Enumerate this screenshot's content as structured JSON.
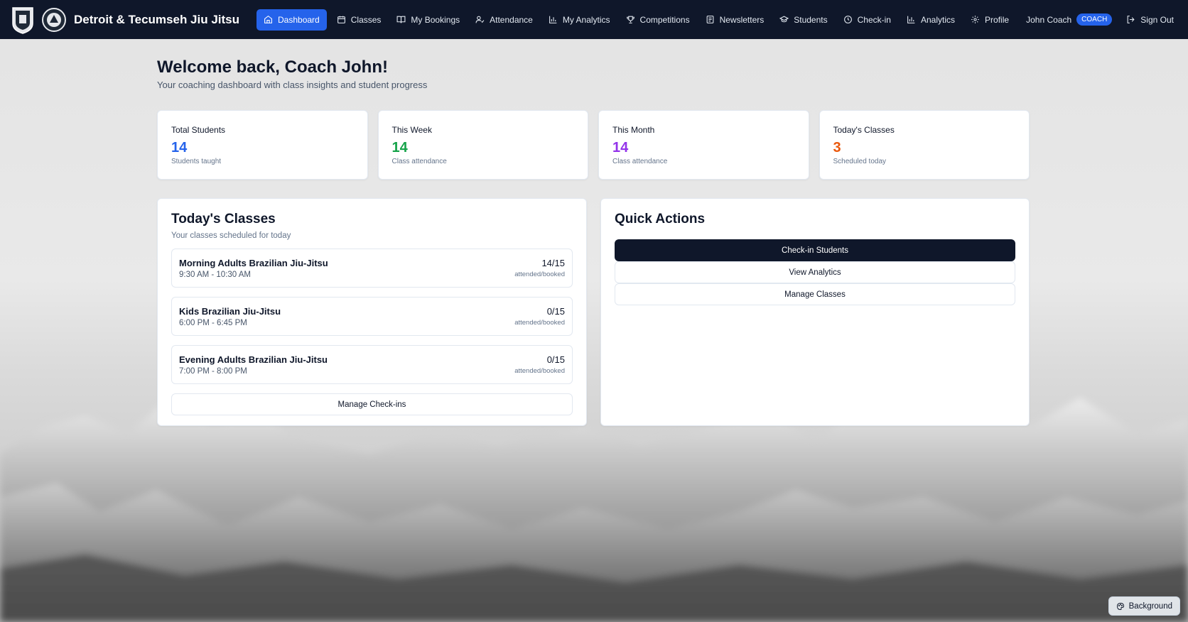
{
  "app": {
    "title": "Detroit & Tecumseh Jiu Jitsu"
  },
  "nav": {
    "items": [
      {
        "label": "Dashboard",
        "icon": "home-icon",
        "active": true
      },
      {
        "label": "Classes",
        "icon": "calendar-icon"
      },
      {
        "label": "My Bookings",
        "icon": "book-icon"
      },
      {
        "label": "Attendance",
        "icon": "user-check-icon"
      },
      {
        "label": "My Analytics",
        "icon": "bar-chart-icon"
      },
      {
        "label": "Competitions",
        "icon": "trophy-icon"
      },
      {
        "label": "Newsletters",
        "icon": "newspaper-icon"
      },
      {
        "label": "Students",
        "icon": "graduation-cap-icon"
      },
      {
        "label": "Check-in",
        "icon": "clock-icon"
      },
      {
        "label": "Analytics",
        "icon": "bar-chart-icon"
      },
      {
        "label": "Profile",
        "icon": "gear-icon"
      }
    ],
    "user_name": "John Coach",
    "role_badge": "COACH",
    "sign_out": "Sign Out"
  },
  "header": {
    "welcome": "Welcome back, Coach John!",
    "subtitle": "Your coaching dashboard with class insights and student progress"
  },
  "stats": [
    {
      "label": "Total Students",
      "value": "14",
      "sub": "Students taught",
      "color": "#2563eb"
    },
    {
      "label": "This Week",
      "value": "14",
      "sub": "Class attendance",
      "color": "#16a34a"
    },
    {
      "label": "This Month",
      "value": "14",
      "sub": "Class attendance",
      "color": "#9333ea"
    },
    {
      "label": "Today's Classes",
      "value": "3",
      "sub": "Scheduled today",
      "color": "#ea580c"
    }
  ],
  "todays_classes": {
    "title": "Today's Classes",
    "subtitle": "Your classes scheduled for today",
    "classes": [
      {
        "name": "Morning Adults Brazilian Jiu-Jitsu",
        "time": "9:30 AM - 10:30 AM",
        "count": "14/15",
        "count_label": "attended/booked"
      },
      {
        "name": "Kids Brazilian Jiu-Jitsu",
        "time": "6:00 PM - 6:45 PM",
        "count": "0/15",
        "count_label": "attended/booked"
      },
      {
        "name": "Evening Adults Brazilian Jiu-Jitsu",
        "time": "7:00 PM - 8:00 PM",
        "count": "0/15",
        "count_label": "attended/booked"
      }
    ],
    "manage_button": "Manage Check-ins"
  },
  "quick_actions": {
    "title": "Quick Actions",
    "primary": "Check-in Students",
    "view_analytics": "View Analytics",
    "manage_classes": "Manage Classes"
  },
  "background_toggle": "Background"
}
